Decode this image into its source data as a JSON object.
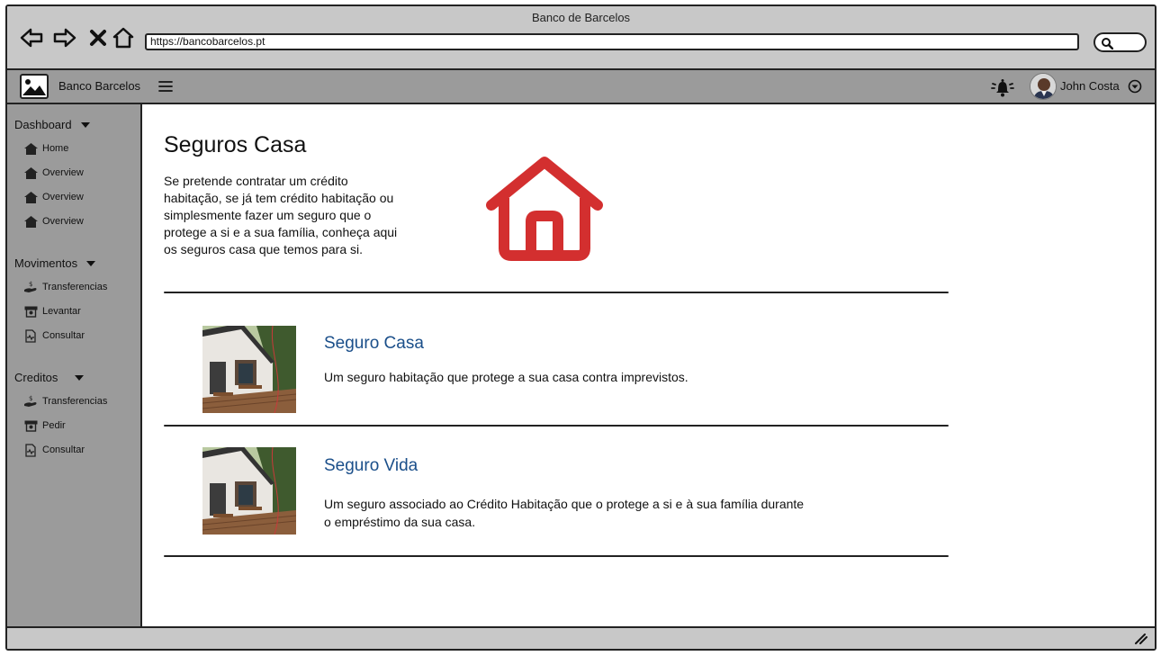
{
  "browser": {
    "window_title": "Banco de Barcelos",
    "url": "https://bancobarcelos.pt"
  },
  "header": {
    "brand": "Banco Barcelos",
    "user_name": "John Costa"
  },
  "sidebar": {
    "sections": [
      {
        "label": "Dashboard",
        "items": [
          {
            "label": "Home",
            "icon": "home-icon"
          },
          {
            "label": "Overview",
            "icon": "home-icon"
          },
          {
            "label": "Overview",
            "icon": "home-icon"
          },
          {
            "label": "Overview",
            "icon": "home-icon"
          }
        ]
      },
      {
        "label": "Movimentos",
        "items": [
          {
            "label": "Transferencias",
            "icon": "money-hand-icon"
          },
          {
            "label": "Levantar",
            "icon": "cash-icon"
          },
          {
            "label": "Consultar",
            "icon": "document-icon"
          }
        ]
      },
      {
        "label": "Creditos",
        "items": [
          {
            "label": "Transferencias",
            "icon": "money-hand-icon"
          },
          {
            "label": "Pedir",
            "icon": "cash-icon"
          },
          {
            "label": "Consultar",
            "icon": "document-icon"
          }
        ]
      }
    ]
  },
  "main": {
    "title": "Seguros Casa",
    "intro_lines": [
      "Se pretende contratar um crédito",
      "habitação, se já tem crédito habitação ou",
      "simplesmente fazer um seguro que o",
      "protege a si e a sua família, conheça aqui",
      "os seguros casa que temos para si."
    ],
    "cards": [
      {
        "title": "Seguro Casa",
        "text_lines": [
          "Um seguro habitação que protege a sua casa contra imprevistos."
        ]
      },
      {
        "title": "Seguro Vida",
        "text_lines": [
          "Um seguro associado ao Crédito Habitação que o protege a si e à sua família durante",
          "o empréstimo da sua casa."
        ]
      }
    ]
  },
  "colors": {
    "accent_red": "#d32f2f",
    "link_blue": "#1b4f8a",
    "chrome_gray": "#c8c8c8",
    "sidebar_gray": "#9b9b9b"
  }
}
